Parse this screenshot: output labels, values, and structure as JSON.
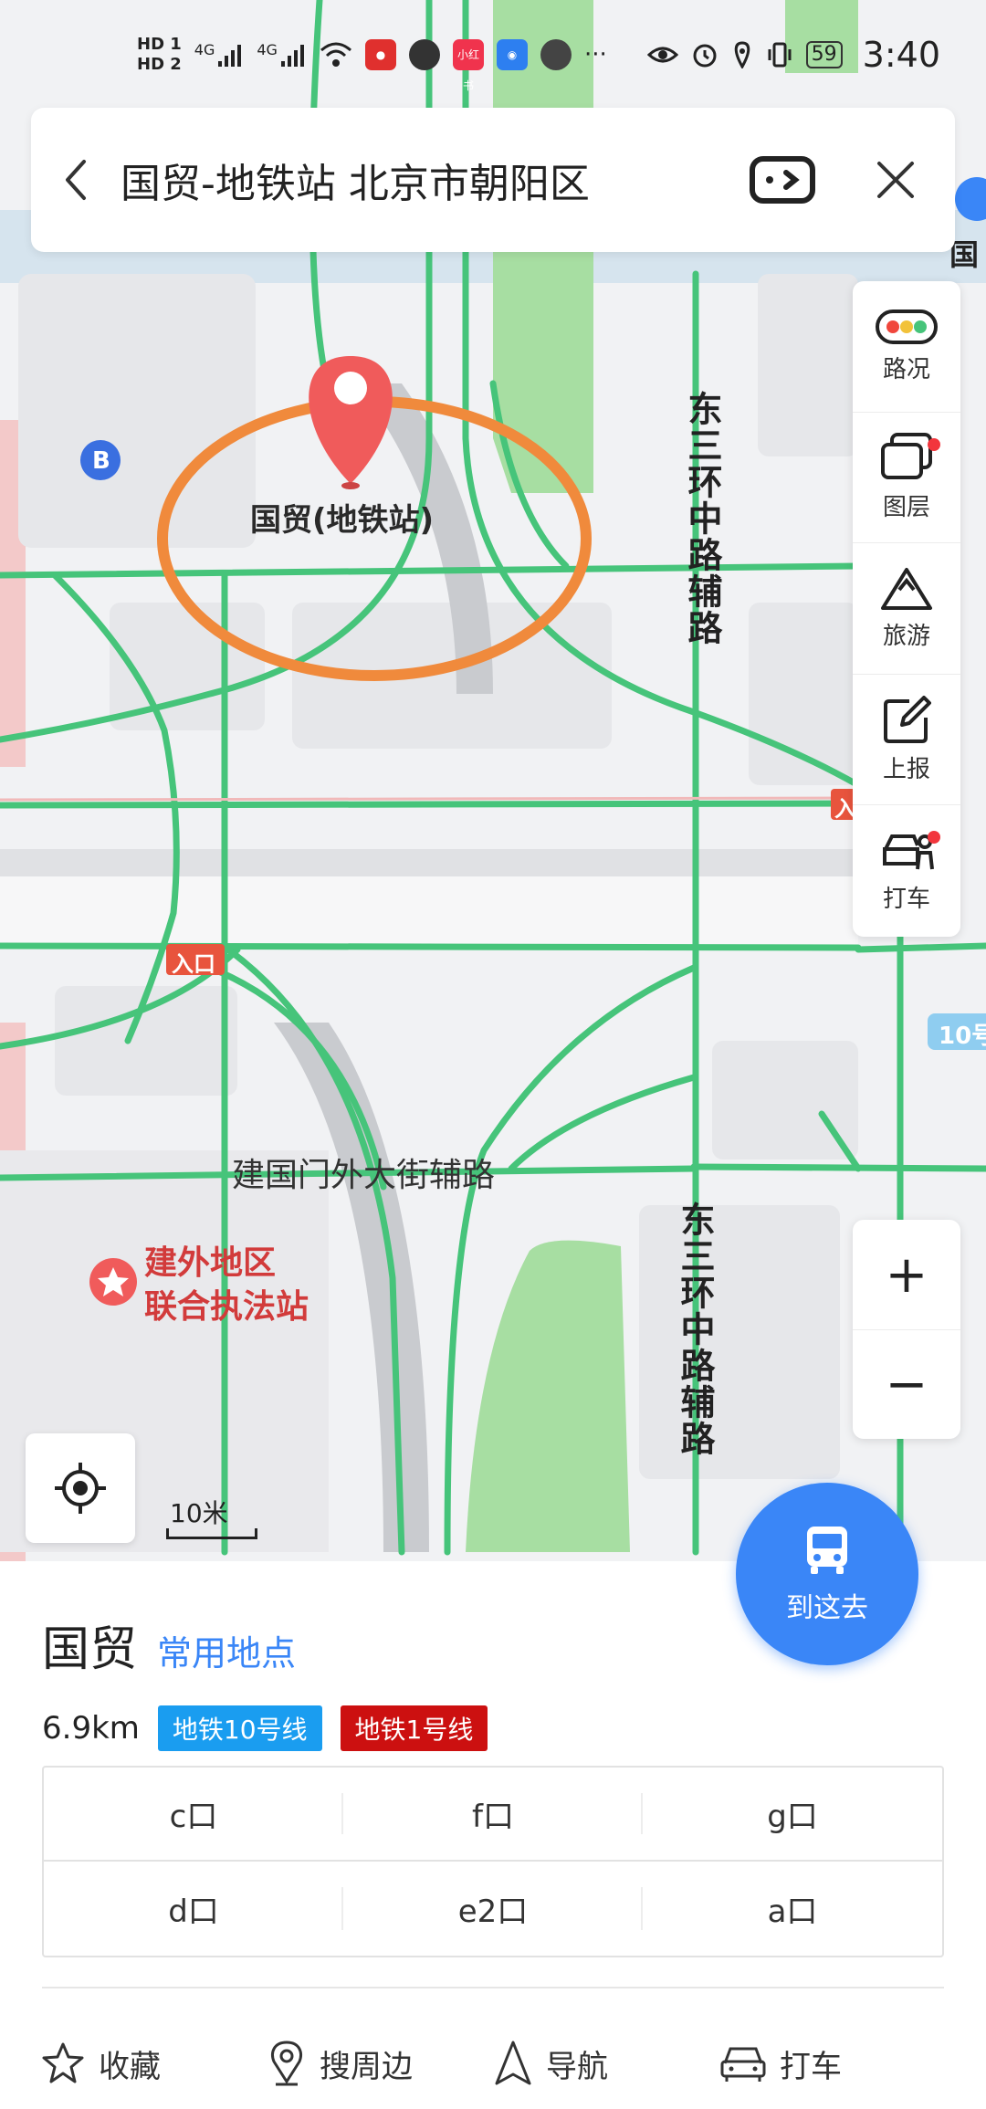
{
  "status_bar": {
    "sim1": "HD 1",
    "sim2": "HD 2",
    "net1": "4G",
    "net2": "4G",
    "app_badge_red": "小红书",
    "more": "···",
    "battery": "59",
    "time": "3:40"
  },
  "search": {
    "query": "国贸-地铁站 北京市朝阳区"
  },
  "tools": {
    "items": [
      {
        "label": "路况"
      },
      {
        "label": "图层"
      },
      {
        "label": "旅游"
      },
      {
        "label": "上报"
      },
      {
        "label": "打车"
      }
    ]
  },
  "map": {
    "poi_name": "国贸(地铁站)",
    "bus_badge": "B",
    "road_vertical_1": "东三环中路辅路",
    "road_vertical_2": "东三环中路辅路",
    "road_horizontal": "建国门外大街辅路",
    "entrance_label": "入口",
    "entrance_label_2": "入",
    "poi_station": "建外地区\n联合执法站",
    "edge_label_top": "国",
    "edge_line_label": "10号",
    "scale": "10米",
    "colors": {
      "road_green": "#46c47a",
      "highlight_orange": "#f08a3c",
      "pin_red": "#f05b5b",
      "park_green": "#a7dea2"
    }
  },
  "zoom": {
    "in": "+",
    "out": "−"
  },
  "go_button": {
    "label": "到这去"
  },
  "place": {
    "name": "国贸",
    "tag": "常用地点",
    "distance": "6.9km",
    "lines": [
      {
        "label": "地铁10号线",
        "color": "#1a9df0"
      },
      {
        "label": "地铁1号线",
        "color": "#cc1010"
      }
    ],
    "exits": [
      "c口",
      "f口",
      "g口",
      "d口",
      "e2口",
      "a口"
    ]
  },
  "actions": [
    {
      "label": "收藏",
      "icon": "star-icon"
    },
    {
      "label": "搜周边",
      "icon": "location-pin-icon"
    },
    {
      "label": "导航",
      "icon": "navigation-arrow-icon"
    },
    {
      "label": "打车",
      "icon": "car-icon"
    }
  ]
}
